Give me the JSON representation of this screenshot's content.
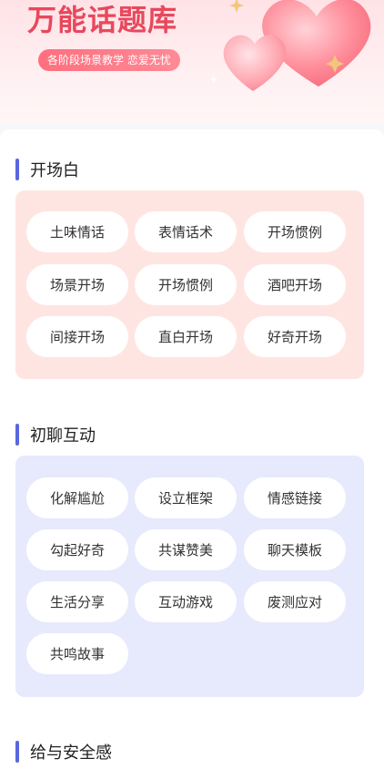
{
  "banner": {
    "title": "万能话题库",
    "tagline": "各阶段场景教学  恋爱无忧"
  },
  "sections": [
    {
      "title": "开场白",
      "items": [
        "土味情话",
        "表情话术",
        "开场惯例",
        "场景开场",
        "开场惯例",
        "酒吧开场",
        "间接开场",
        "直白开场",
        "好奇开场"
      ]
    },
    {
      "title": "初聊互动",
      "items": [
        "化解尴尬",
        "设立框架",
        "情感链接",
        "勾起好奇",
        "共谋赞美",
        "聊天模板",
        "生活分享",
        "互动游戏",
        "废测应对",
        "共鸣故事"
      ]
    },
    {
      "title": "给与安全感"
    }
  ],
  "colors": {
    "accent_bar": "#5a67e0",
    "panel_pink": "#ffe5e2",
    "panel_blue": "#e7e9fc",
    "banner_title": "#e8485c"
  },
  "icons": [
    "heart-icon",
    "sparkle-icon"
  ]
}
